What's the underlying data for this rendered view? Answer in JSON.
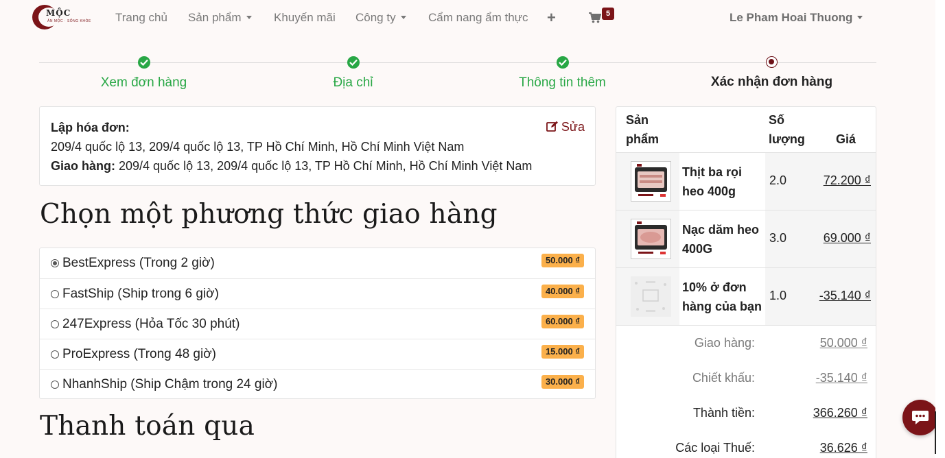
{
  "brand": {
    "logo_text": "MỘC",
    "logo_sub": "ĂN MỘC · SỐNG KHỎE",
    "accent": "#7b1418"
  },
  "nav": {
    "items": [
      {
        "label": "Trang chủ",
        "dropdown": false
      },
      {
        "label": "Sản phẩm",
        "dropdown": true
      },
      {
        "label": "Khuyến mãi",
        "dropdown": false
      },
      {
        "label": "Công ty",
        "dropdown": true
      },
      {
        "label": "Cẩm nang ẩm thực",
        "dropdown": false
      }
    ],
    "plus_icon": "plus-icon",
    "cart_icon": "cart-icon",
    "cart_count": "5",
    "user_name": "Le Pham Hoai Thuong"
  },
  "steps": [
    {
      "label": "Xem đơn hàng",
      "status": "done"
    },
    {
      "label": "Địa chỉ",
      "status": "done"
    },
    {
      "label": "Thông tin thêm",
      "status": "done"
    },
    {
      "label": "Xác nhận đơn hàng",
      "status": "current"
    }
  ],
  "address": {
    "billing_title": "Lập hóa đơn:",
    "billing_address": "209/4 quốc lộ 13, 209/4 quốc lộ 13, TP Hồ Chí Minh, Hồ Chí Minh Việt Nam",
    "shipping_title": "Giao hàng:",
    "shipping_address": " 209/4 quốc lộ 13, 209/4 quốc lộ 13, TP Hồ Chí Minh, Hồ Chí Minh Việt Nam",
    "edit_label": "Sửa"
  },
  "shipping": {
    "heading": "Chọn một phương thức giao hàng",
    "options": [
      {
        "label": "BestExpress (Trong 2 giờ)",
        "price": "50.000 ₫",
        "selected": true
      },
      {
        "label": "FastShip (Ship trong 6 giờ)",
        "price": "40.000 ₫",
        "selected": false
      },
      {
        "label": "247Express (Hỏa Tốc 30 phút)",
        "price": "60.000 ₫",
        "selected": false
      },
      {
        "label": "ProExpress (Trong 48 giờ)",
        "price": "15.000 ₫",
        "selected": false
      },
      {
        "label": "NhanhShip (Ship Chậm trong 24 giờ)",
        "price": "30.000 ₫",
        "selected": false
      }
    ]
  },
  "payment": {
    "heading": "Thanh toán qua"
  },
  "summary": {
    "headers": {
      "product_1": "Sản",
      "product_2": "phẩm",
      "qty_1": "Số",
      "qty_2": "lượng",
      "price": "Giá"
    },
    "items": [
      {
        "name_1": "Thịt ba rọi",
        "name_2": "heo 400g",
        "qty": "2.0",
        "price": "72.200 ₫"
      },
      {
        "name_1": "Nạc dăm heo",
        "name_2": "400G",
        "qty": "3.0",
        "price": "69.000 ₫"
      },
      {
        "name_1": "10% ở đơn",
        "name_2": "hàng của bạn",
        "qty": "1.0",
        "price": "-35.140 ₫"
      }
    ],
    "totals": {
      "shipping_label": "Giao hàng:",
      "shipping_value": "50.000 ₫",
      "discount_label": "Chiết khấu:",
      "discount_value": "-35.140 ₫",
      "subtotal_label": "Thành tiền:",
      "subtotal_value": "366.260 ₫",
      "tax_label": "Các loại Thuế:",
      "tax_value": "36.626 ₫"
    }
  },
  "chat": {
    "icon": "chat-icon"
  }
}
